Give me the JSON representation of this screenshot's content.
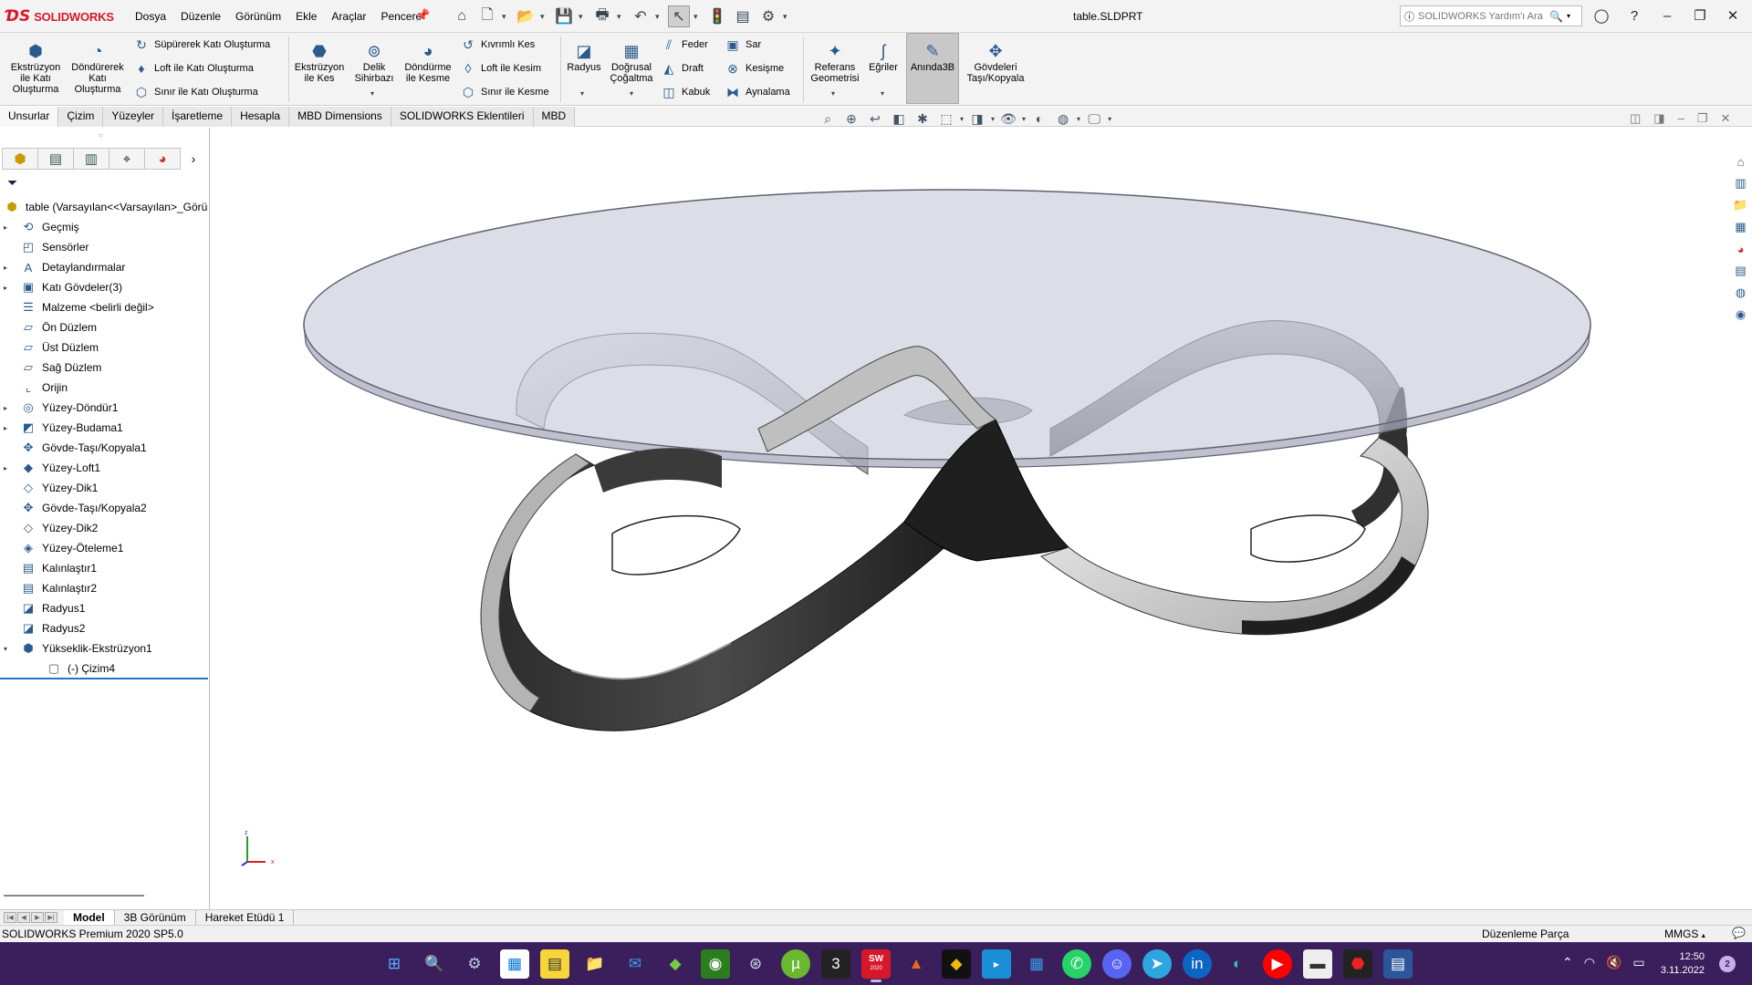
{
  "titlebar": {
    "logo_ds": "ƊS",
    "logo_text": "SOLIDWORKS",
    "menus": [
      "Dosya",
      "Düzenle",
      "Görünüm",
      "Ekle",
      "Araçlar",
      "Pencere"
    ],
    "document_title": "table.SLDPRT",
    "search_placeholder": "SOLIDWORKS Yardım'ı Ara"
  },
  "ribbon": {
    "extrude_boss": "Ekstrüzyon ile Katı Oluşturma",
    "revolve_boss": "Döndürerek Katı Oluşturma",
    "swept_boss": "Süpürerek Katı Oluşturma",
    "loft_boss": "Loft ile Katı Oluşturma",
    "boundary_boss": "Sınır ile Katı Oluşturma",
    "extrude_cut": "Ekstrüzyon ile Kes",
    "hole_wizard": "Delik Sihirbazı",
    "revolve_cut": "Döndürme ile Kesme",
    "swept_cut": "Kıvrımlı Kes",
    "loft_cut": "Loft ile Kesim",
    "boundary_cut": "Sınır ile Kesme",
    "fillet": "Radyus",
    "linear_pattern": "Doğrusal Çoğaltma",
    "rib": "Feder",
    "draft": "Draft",
    "shell": "Kabuk",
    "wrap": "Sar",
    "intersect": "Kesişme",
    "mirror": "Aynalama",
    "ref_geometry": "Referans Geometrisi",
    "curves": "Eğriler",
    "instant3d": "Anında3B",
    "move_copy_bodies": "Gövdeleri Taşı/Kopyala"
  },
  "tabs": [
    "Unsurlar",
    "Çizim",
    "Yüzeyler",
    "İşaretleme",
    "Hesapla",
    "MBD Dimensions",
    "SOLIDWORKS Eklentileri",
    "MBD"
  ],
  "tree": {
    "root": "table  (Varsayılan<<Varsayılan>_Görü",
    "items": [
      {
        "label": "Geçmiş",
        "icon": "history-icon",
        "expand": "▸"
      },
      {
        "label": "Sensörler",
        "icon": "sensor-icon",
        "expand": ""
      },
      {
        "label": "Detaylandırmalar",
        "icon": "annotation-icon",
        "expand": "▸"
      },
      {
        "label": "Katı Gövdeler(3)",
        "icon": "solid-bodies-icon",
        "expand": "▸"
      },
      {
        "label": "Malzeme <belirli değil>",
        "icon": "material-icon",
        "expand": ""
      },
      {
        "label": "Ön Düzlem",
        "icon": "plane-icon",
        "expand": ""
      },
      {
        "label": "Üst Düzlem",
        "icon": "plane-icon",
        "expand": ""
      },
      {
        "label": "Sağ Düzlem",
        "icon": "plane-icon",
        "expand": ""
      },
      {
        "label": "Orijin",
        "icon": "origin-icon",
        "expand": ""
      },
      {
        "label": "Yüzey-Döndür1",
        "icon": "surface-revolve-icon",
        "expand": "▸"
      },
      {
        "label": "Yüzey-Budama1",
        "icon": "surface-trim-icon",
        "expand": "▸"
      },
      {
        "label": "Gövde-Taşı/Kopyala1",
        "icon": "move-copy-icon",
        "expand": ""
      },
      {
        "label": "Yüzey-Loft1",
        "icon": "surface-loft-icon",
        "expand": "▸"
      },
      {
        "label": "Yüzey-Dik1",
        "icon": "surface-knit-icon",
        "expand": ""
      },
      {
        "label": "Gövde-Taşı/Kopyala2",
        "icon": "move-copy-icon",
        "expand": ""
      },
      {
        "label": "Yüzey-Dik2",
        "icon": "surface-knit-icon",
        "expand": ""
      },
      {
        "label": "Yüzey-Öteleme1",
        "icon": "surface-offset-icon",
        "expand": ""
      },
      {
        "label": "Kalınlaştır1",
        "icon": "thicken-icon",
        "expand": ""
      },
      {
        "label": "Kalınlaştır2",
        "icon": "thicken-icon",
        "expand": ""
      },
      {
        "label": "Radyus1",
        "icon": "fillet-icon",
        "expand": ""
      },
      {
        "label": "Radyus2",
        "icon": "fillet-icon",
        "expand": ""
      },
      {
        "label": "Yükseklik-Ekstrüzyon1",
        "icon": "extrude-icon",
        "expand": "▾"
      }
    ],
    "child": "(-) Çizim4"
  },
  "bottom_tabs": [
    "Model",
    "3B Görünüm",
    "Hareket Etüdü 1"
  ],
  "status": {
    "version": "SOLIDWORKS Premium 2020 SP5.0",
    "mode": "Düzenleme Parça",
    "units": "MMGS"
  },
  "triad": {
    "x": "x",
    "y": "y",
    "z": "z"
  },
  "taskbar": {
    "time": "12:50",
    "date": "3.11.2022",
    "notifications": "2",
    "sw_badge": "2020"
  },
  "colors": {
    "accent": "#1f76c3",
    "brand": "#d6182a",
    "taskbar": "#3a1f5c"
  }
}
